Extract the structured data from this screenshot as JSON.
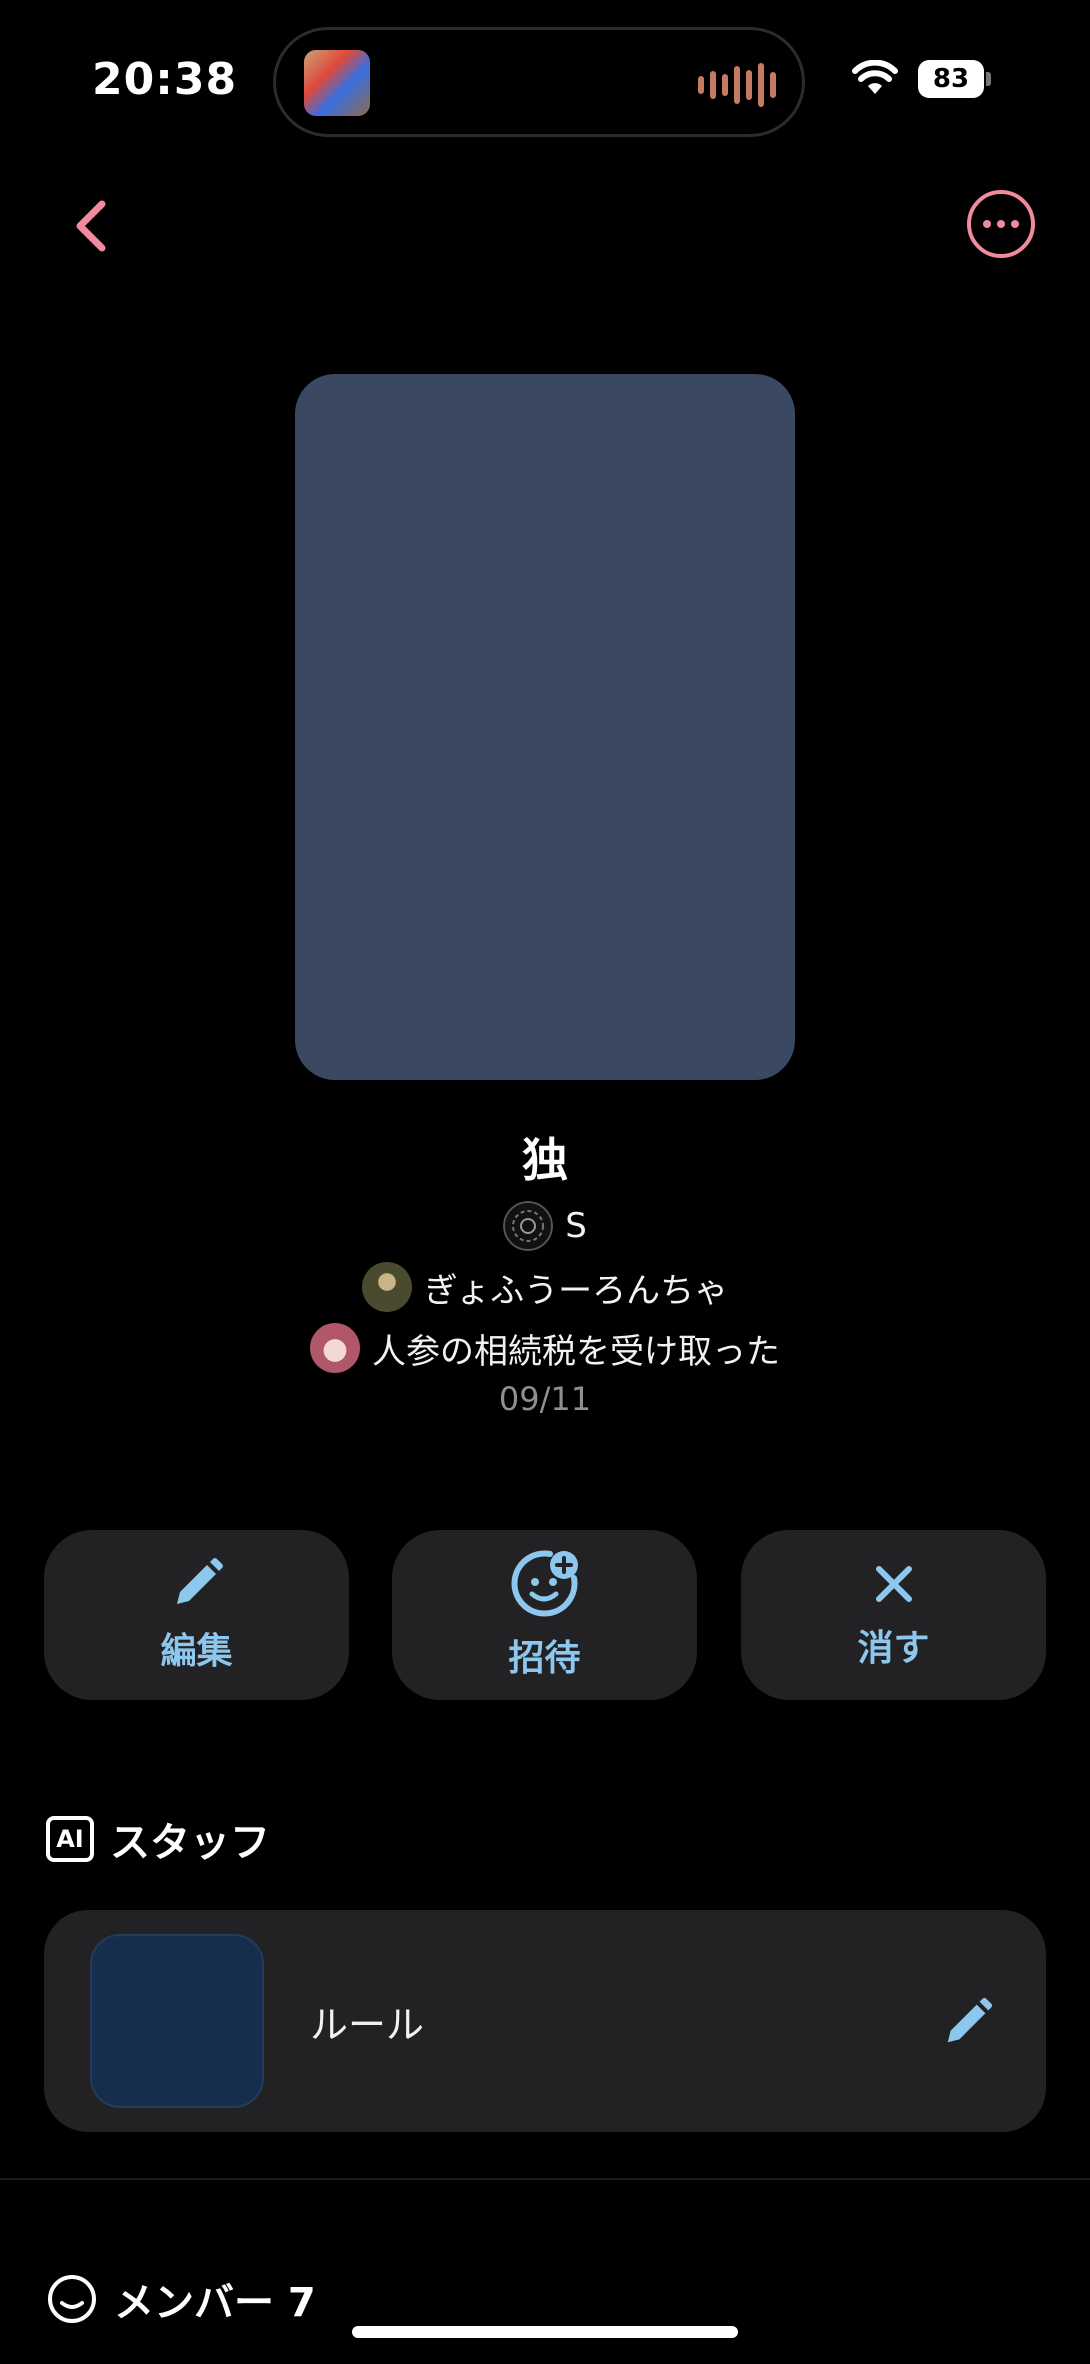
{
  "status_bar": {
    "time": "20:38",
    "battery": "83",
    "icons": [
      "now-playing-artwork",
      "audio-waveform-icon",
      "wifi-icon",
      "battery-icon"
    ]
  },
  "nav": {
    "back_icon": "chevron-left-icon",
    "more_icon": "ellipsis-circle-icon",
    "accent_color": "#f08a9c"
  },
  "room": {
    "title": "独",
    "cover_color": "#3a4862",
    "members": [
      {
        "name": "S"
      },
      {
        "name": "ぎょふうーろんちゃ"
      },
      {
        "name": "人参の相続税を受け取った"
      }
    ],
    "date": "09/11"
  },
  "actions": [
    {
      "label": "編集",
      "icon": "pencil-icon"
    },
    {
      "label": "招待",
      "icon": "add-person-icon"
    },
    {
      "label": "消す",
      "icon": "close-icon"
    }
  ],
  "action_color": "#8ec7ee",
  "staff_section": {
    "badge": "AI",
    "title": "スタッフ",
    "items": [
      {
        "name": "ルール",
        "edit_icon": "pencil-icon"
      }
    ]
  },
  "members_section": {
    "title": "メンバー 7",
    "icon": "smile-icon"
  }
}
